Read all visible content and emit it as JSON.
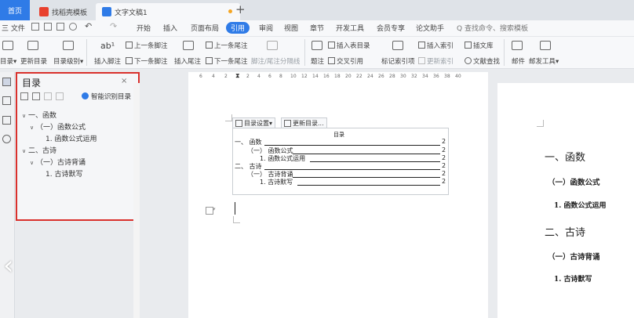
{
  "tabs": {
    "home": "首页",
    "templates": "找稻壳模板",
    "document": "文字文稿1"
  },
  "menu": {
    "file": "三 文件",
    "items": [
      "开始",
      "插入",
      "页面布局",
      "引用",
      "审阅",
      "视图",
      "章节",
      "开发工具",
      "会员专享",
      "论文助手"
    ],
    "search": "Q 查找命令、搜索模板"
  },
  "ribbon": {
    "toc": "目录",
    "update_toc": "更新目录",
    "toc_level": "目录级别",
    "insert_footnote": "插入脚注",
    "prev_footnote": "上一条脚注",
    "next_footnote": "下一条脚注",
    "insert_endnote": "插入尾注",
    "prev_endnote": "上一条尾注",
    "next_endnote": "下一条尾注",
    "footnote_sep": "脚注/尾注分隔线",
    "caption": "题注",
    "insert_table_of_figures": "插入表目录",
    "cross_ref": "交叉引用",
    "mark_index": "标记索引项",
    "insert_index": "插入索引",
    "update_index": "更新索引",
    "bibliography": "插文库",
    "doc_check": "文献查找",
    "mail": "邮件",
    "mail_merge": "邮发工具"
  },
  "toc_panel": {
    "title": "目录",
    "smart_toc": "智能识别目录",
    "items": [
      "一、函数",
      "（一）函数公式",
      "1. 函数公式运用",
      "二、古诗",
      "（一）古诗背诵",
      "1. 古诗默写"
    ]
  },
  "ruler_ticks": [
    "6",
    "4",
    "2",
    "2",
    "4",
    "6",
    "8",
    "10",
    "12",
    "14",
    "16",
    "18",
    "20",
    "22",
    "24",
    "26",
    "28",
    "30",
    "32",
    "34",
    "36",
    "38",
    "40"
  ],
  "doc_toc": {
    "settings_button": "目录设置",
    "update_button": "更新目录...",
    "heading": "目录",
    "entries": [
      {
        "text": "函数",
        "prefix": "一、",
        "page": "2"
      },
      {
        "text": "函数公式",
        "prefix": "（一）",
        "page": "2"
      },
      {
        "text": "函数公式运用",
        "prefix": "1.",
        "page": "2"
      },
      {
        "text": "古诗",
        "prefix": "二、",
        "page": "2"
      },
      {
        "text": "古诗背诵",
        "prefix": "（一）",
        "page": "2"
      },
      {
        "text": "古诗默写",
        "prefix": "1.",
        "page": "2"
      }
    ]
  },
  "page2": {
    "h1": "一、函数",
    "h2": "（一）函数公式",
    "h3": "1. 函数公式运用",
    "h4": "二、古诗",
    "h5": "（一）古诗背诵",
    "h6": "1. 古诗默写"
  },
  "colors": {
    "accent": "#2f7be7",
    "highlight_border": "#d9302c",
    "wps_red": "#e8402d"
  }
}
